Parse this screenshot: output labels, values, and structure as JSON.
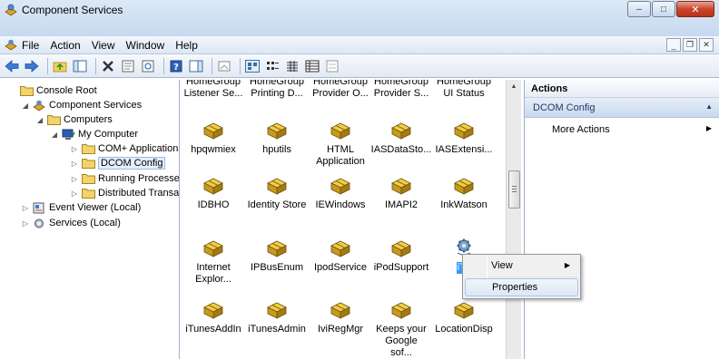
{
  "window": {
    "title": "Component Services"
  },
  "menu": [
    "File",
    "Action",
    "View",
    "Window",
    "Help"
  ],
  "tree": {
    "items": [
      {
        "label": "Console Root",
        "icon": "folder-icon"
      },
      {
        "label": "Component Services",
        "icon": "component-services-icon"
      },
      {
        "label": "Computers",
        "icon": "folder-icon"
      },
      {
        "label": "My Computer",
        "icon": "computer-icon"
      },
      {
        "label": "COM+ Applications",
        "icon": "folder-icon"
      },
      {
        "label": "DCOM Config",
        "icon": "folder-icon"
      },
      {
        "label": "Running Processes",
        "icon": "folder-icon"
      },
      {
        "label": "Distributed Transaction Coordinator",
        "icon": "folder-icon"
      },
      {
        "label": "Event Viewer (Local)",
        "icon": "event-viewer-icon"
      },
      {
        "label": "Services (Local)",
        "icon": "services-icon"
      }
    ]
  },
  "grid": {
    "top_row": [
      {
        "line1": "HomeGroup",
        "line2": "Listener Se..."
      },
      {
        "line1": "HomeGroup",
        "line2": "Printing D..."
      },
      {
        "line1": "HomeGroup",
        "line2": "Provider O..."
      },
      {
        "line1": "HomeGroup",
        "line2": "Provider S..."
      },
      {
        "line1": "HomeGroup",
        "line2": "UI Status"
      }
    ],
    "rows": [
      [
        "hpqwmiex",
        "hputils",
        "HTML Application",
        "IASDataSto...",
        "IASExtensi..."
      ],
      [
        "IDBHO",
        "Identity Store",
        "IEWindows",
        "IMAPI2",
        "InkWatson"
      ],
      [
        "Internet Explor...",
        "IPBusEnum",
        "IpodService",
        "iPodSupport",
        "iTu"
      ],
      [
        "iTunesAddIn",
        "iTunesAdmin",
        "IviRegMgr",
        "Keeps your Google sof...",
        "LocationDisp"
      ]
    ]
  },
  "actions": {
    "header": "Actions",
    "section": "DCOM Config",
    "more": "More Actions"
  },
  "context_menu": {
    "view": "View",
    "properties": "Properties"
  },
  "colors": {
    "selection": "#3399ff",
    "package": "#c9a227"
  }
}
